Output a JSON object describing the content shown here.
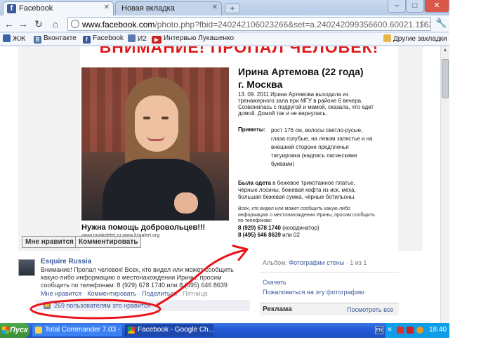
{
  "browser": {
    "tabs": [
      {
        "label": "Facebook",
        "active": true
      },
      {
        "label": "Новая вкладка",
        "active": false
      }
    ],
    "new_tab_glyph": "+",
    "url_host": "www.facebook.com",
    "url_path": "/photo.php?fbid=240242106023266&set=a.240242099356600.60021.1163",
    "bookmarks": [
      {
        "label": "ЖЖ",
        "icon": "user-icon",
        "color": "#3a63a8"
      },
      {
        "label": "Вконтакте",
        "icon": "vk-icon",
        "color": "#4a76a8"
      },
      {
        "label": "Facebook",
        "icon": "facebook-icon",
        "color": "#3b5998"
      },
      {
        "label": "И2",
        "icon": "user-icon",
        "color": "#5a7ab0"
      },
      {
        "label": "Интервью Лукашенко",
        "icon": "youtube-icon",
        "color": "#cc2222"
      }
    ],
    "other_bookmarks": "Другие закладки"
  },
  "photo": {
    "poster": {
      "header": "ВНИМАНИЕ! ПРОПАЛ ЧЕЛОВЕК!",
      "name": "Ирина Артемова (22 года)",
      "city": "г. Москва",
      "story": "13. 09. 2011 Ирина Артемова выходила из тренажерного зала при МГУ в районе 6 вечера. Созвонилась с подругой и мамой, сказала, что едет домой. Домой так и не вернулась.",
      "signs_label": "Приметы:",
      "signs": "рост 176 см, волосы светло-русые, глаза голубые, на левом запястье и на внешней стороне предплечья татуировка (надпись латинскими буквами)",
      "dressed_label": "Была одета",
      "dressed": "в бежевое трикотажное платье, чёрные лосины, бежевая кофта из иск. меха, большая бежевая сумка, чёрные ботильоны.",
      "contact": "Всех, кто видел или может сообщить какую-либо информацию о местонахождении Ирины, просим сообщить по телефонам:",
      "phone1": "8 (929) 678 1740",
      "phone1_note": "(координатор)",
      "phone2": "8 (495) 646 8639",
      "phone2_note": "или 02",
      "need_help": "Нужна помощь добровольцев!!!",
      "site_links": "www.poiskdetei.ru      www.lizaalert.org"
    },
    "like_button": "Мне нравится",
    "comment_button": "Комментировать"
  },
  "post": {
    "author": "Esquire Russia",
    "text": "Внимание! Пропал человек! Всех, кто видел или может сообщить какую-либо информацию о местонахождении Ирины, просим сообщить по телефонам: 8 (929) 678 1740 или 8 (495) 646 8639",
    "actions": [
      "Мне нравится",
      "Комментировать",
      "Поделиться",
      "Пятница"
    ],
    "likes": "269 пользователям это нравится"
  },
  "sidebar": {
    "album_label": "Альбом:",
    "album_name": "Фотографии стены",
    "album_count": "· 1 из 1",
    "download": "Скачать",
    "complain": "Пожаловаться на эту фотографию",
    "ads_title": "Реклама",
    "ads_all": "Посмотреть все"
  },
  "taskbar": {
    "start": "Пуск",
    "tasks": [
      {
        "label": "Total Commander 7.03 - ...",
        "icon": "total-commander-icon"
      },
      {
        "label": "Facebook - Google Ch...",
        "icon": "chrome-icon"
      }
    ],
    "lang": "EN",
    "tray_expand": "«",
    "clock": "18:40"
  },
  "colors": {
    "facebook_blue": "#3b5998",
    "annotation_red": "#e8141a",
    "poster_red": "#e01818"
  }
}
